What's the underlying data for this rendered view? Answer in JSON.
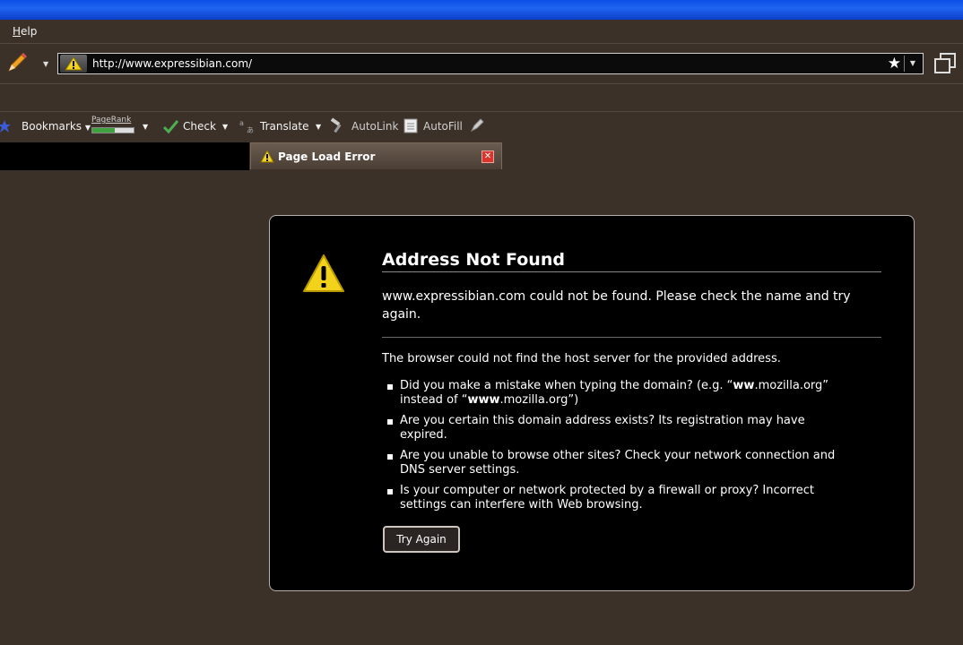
{
  "menu": {
    "help": "Help"
  },
  "address_bar": {
    "url": "http://www.expressibian.com/"
  },
  "toolbar": {
    "bookmarks": "Bookmarks",
    "pagerank_label": "PageRank",
    "pagerank_fraction": 0.55,
    "check": "Check",
    "translate": "Translate",
    "autolink": "AutoLink",
    "autofill": "AutoFill"
  },
  "tab": {
    "title": "Page Load Error"
  },
  "error": {
    "title": "Address Not Found",
    "short_desc": "www.expressibian.com could not be found. Please check the name and try again.",
    "long_desc": "The browser could not find the host server for the provided address.",
    "bullet1_a": "Did you make a mistake when typing the domain? (e.g. “",
    "bullet1_b": "ww",
    "bullet1_c": ".mozilla.org” instead of “",
    "bullet1_d": "www",
    "bullet1_e": ".mozilla.org”)",
    "bullet2": "Are you certain this domain address exists? Its registration may have expired.",
    "bullet3": "Are you unable to browse other sites? Check your network connection and DNS server settings.",
    "bullet4": "Is your computer or network protected by a firewall or proxy? Incorrect settings can interfere with Web browsing.",
    "try_again": "Try Again"
  },
  "colors": {
    "background": "#3b3129",
    "error_panel": "#000000",
    "title_bar": "#1f64f0",
    "warning": "#f2d21b"
  }
}
